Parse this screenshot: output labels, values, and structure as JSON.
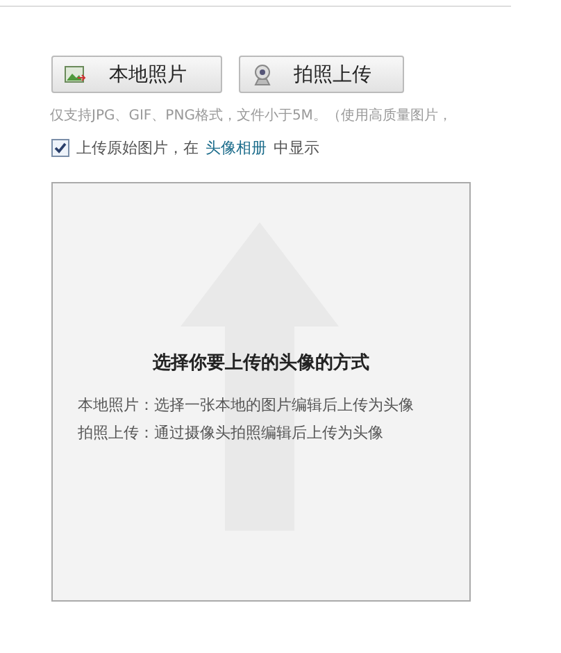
{
  "buttons": [
    {
      "kind": "local",
      "label": "本地照片"
    },
    {
      "kind": "camera",
      "label": "拍照上传"
    }
  ],
  "hint": "仅支持JPG、GIF、PNG格式，文件小于5M。（使用高质量图片，",
  "option": {
    "checked": true,
    "before": "上传原始图片，在",
    "link": "头像相册",
    "after": "中显示"
  },
  "panel": {
    "title": "选择你要上传的头像的方式",
    "lines": [
      "本地照片：选择一张本地的图片编辑后上传为头像",
      "拍照上传：通过摄像头拍照编辑后上传为头像"
    ]
  }
}
